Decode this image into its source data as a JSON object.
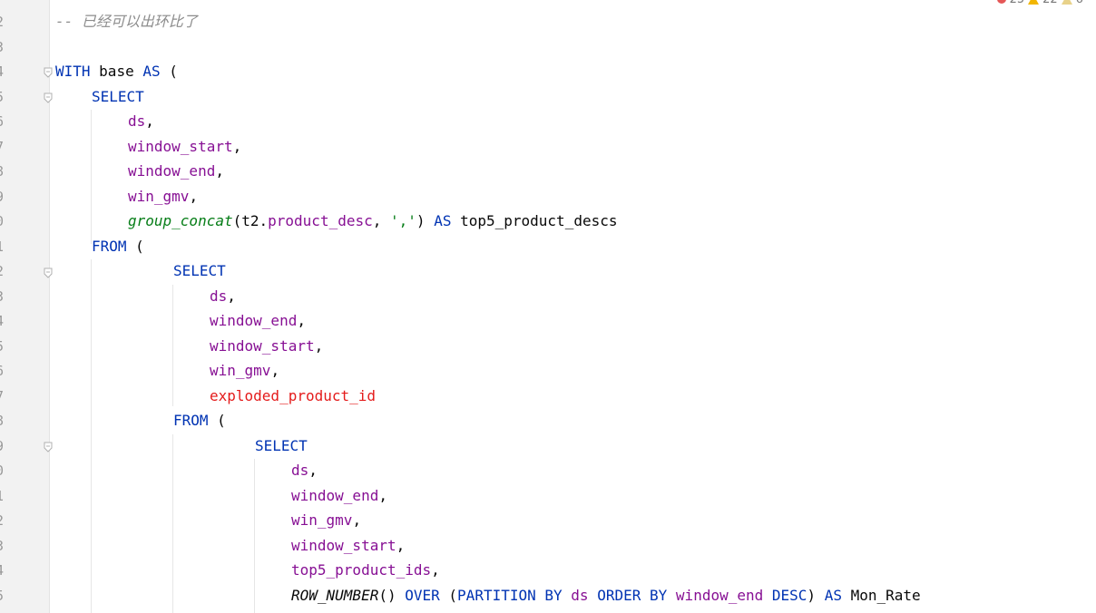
{
  "gutter": {
    "line_numbers": [
      "2",
      "3",
      "4",
      "5",
      "6",
      "7",
      "8",
      "9",
      "0",
      "1",
      "2",
      "3",
      "4",
      "5",
      "6",
      "7",
      "8",
      "9",
      "0",
      "1",
      "2",
      "3",
      "4",
      "5"
    ]
  },
  "inspections": {
    "errors": "25",
    "warnings": "22",
    "weak_warnings": "6"
  },
  "code": {
    "comment": "-- 已经可以出环比了",
    "kw_with": "WITH",
    "base": "base",
    "kw_as": "AS",
    "paren_open": "(",
    "paren_close": ")",
    "kw_select": "SELECT",
    "kw_from": "FROM",
    "comma": ",",
    "ds": "ds",
    "window_start": "window_start",
    "window_end": "window_end",
    "win_gmv": "win_gmv",
    "group_concat": "group_concat",
    "t2_prefix": "t2.",
    "product_desc": "product_desc",
    "comma_space": ", ",
    "sep_string": "','",
    "top5_product_descs": "top5_product_descs",
    "exploded_product_id": "exploded_product_id",
    "top5_product_ids": "top5_product_ids",
    "row_number": "ROW_NUMBER",
    "empty_parens": "()",
    "kw_over": "OVER",
    "kw_partition": "PARTITION",
    "kw_by": "BY",
    "kw_order": "ORDER",
    "kw_desc": "DESC",
    "mon_rate": "Mon_Rate"
  }
}
